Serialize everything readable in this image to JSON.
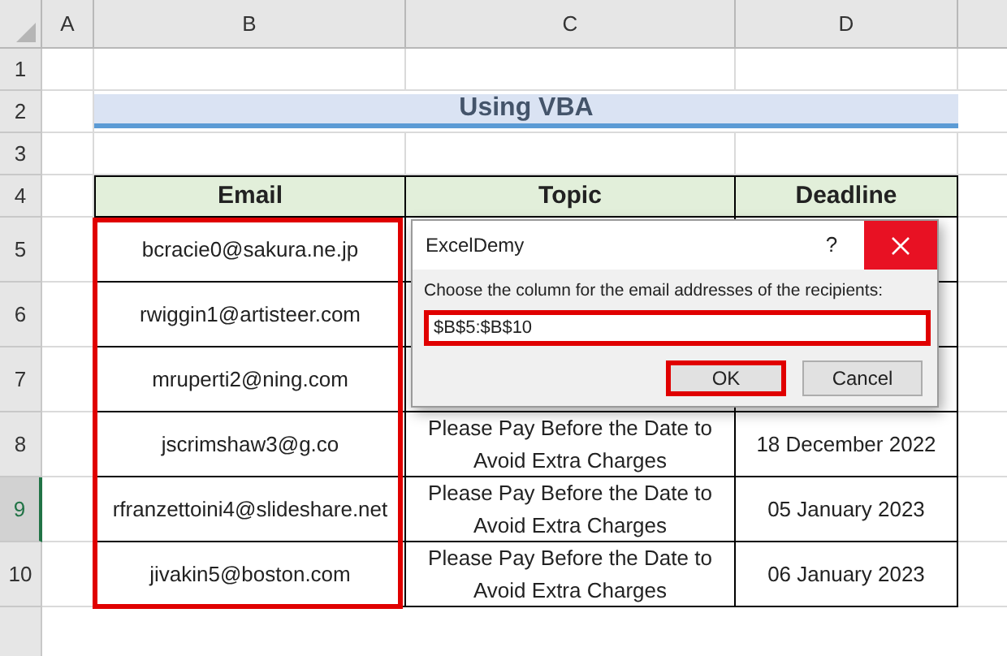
{
  "columns": [
    {
      "label": "A"
    },
    {
      "label": "B"
    },
    {
      "label": "C"
    },
    {
      "label": "D"
    }
  ],
  "rows": [
    {
      "label": "1",
      "selected": false
    },
    {
      "label": "2",
      "selected": false
    },
    {
      "label": "3",
      "selected": false
    },
    {
      "label": "4",
      "selected": false
    },
    {
      "label": "5",
      "selected": false
    },
    {
      "label": "6",
      "selected": false
    },
    {
      "label": "7",
      "selected": false
    },
    {
      "label": "8",
      "selected": false
    },
    {
      "label": "9",
      "selected": true
    },
    {
      "label": "10",
      "selected": false
    }
  ],
  "title": "Using VBA",
  "table": {
    "columns": [
      "Email",
      "Topic",
      "Deadline"
    ],
    "rows": [
      {
        "email": "bcracie0@sakura.ne.jp"
      },
      {
        "email": "rwiggin1@artisteer.com"
      },
      {
        "email": "mruperti2@ning.com"
      },
      {
        "email": "jscrimshaw3@g.co",
        "topic": "Please Pay Before the Date to Avoid Extra Charges",
        "deadline": "18 December 2022"
      },
      {
        "email": "rfranzettoini4@slideshare.net",
        "topic": "Please Pay Before the Date to Avoid Extra Charges",
        "deadline": "05 January 2023"
      },
      {
        "email": "jivakin5@boston.com",
        "topic": "Please Pay Before the Date to Avoid Extra Charges",
        "deadline": "06 January 2023"
      }
    ]
  },
  "dialog": {
    "title": "ExcelDemy",
    "help": "?",
    "prompt": "Choose the column for the email addresses of the recipients:",
    "value": "$B$5:$B$10",
    "buttons": [
      {
        "label": "OK",
        "highlighted": true
      },
      {
        "label": "Cancel",
        "highlighted": false
      }
    ]
  }
}
